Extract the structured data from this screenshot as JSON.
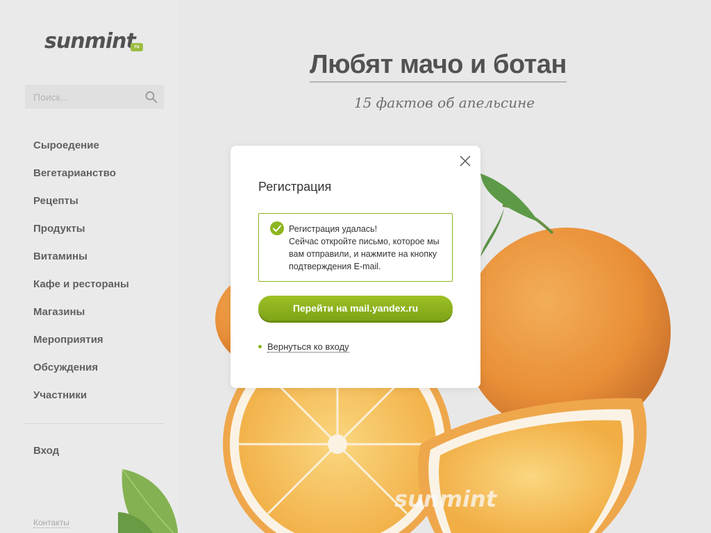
{
  "brand": {
    "logo_text": "sunmint",
    "logo_badge": "ru",
    "watermark": "sunmint"
  },
  "search": {
    "placeholder": "Поиск..."
  },
  "nav": {
    "items": [
      {
        "label": "Сыроедение"
      },
      {
        "label": "Вегетарианство"
      },
      {
        "label": "Рецепты"
      },
      {
        "label": "Продукты"
      },
      {
        "label": "Витамины"
      },
      {
        "label": "Кафе и рестораны"
      },
      {
        "label": "Магазины"
      },
      {
        "label": "Мероприятия"
      },
      {
        "label": "Обсуждения"
      },
      {
        "label": "Участники"
      }
    ],
    "login": "Вход",
    "contacts": "Контакты"
  },
  "article": {
    "title": "Любят мачо и ботан",
    "subtitle": "15 фактов об апельсине"
  },
  "modal": {
    "title": "Регистрация",
    "notice_lines": [
      "Регистрация удалась!",
      "Сейчас откройте письмо, которое мы вам отправили, и нажмите на кнопку подтверждения E-mail."
    ],
    "primary_button": "Перейти на mail.yandex.ru",
    "back_link": "Вернуться ко входу"
  },
  "colors": {
    "accent": "#8db51f",
    "text": "#333333",
    "background": "#ececec"
  }
}
